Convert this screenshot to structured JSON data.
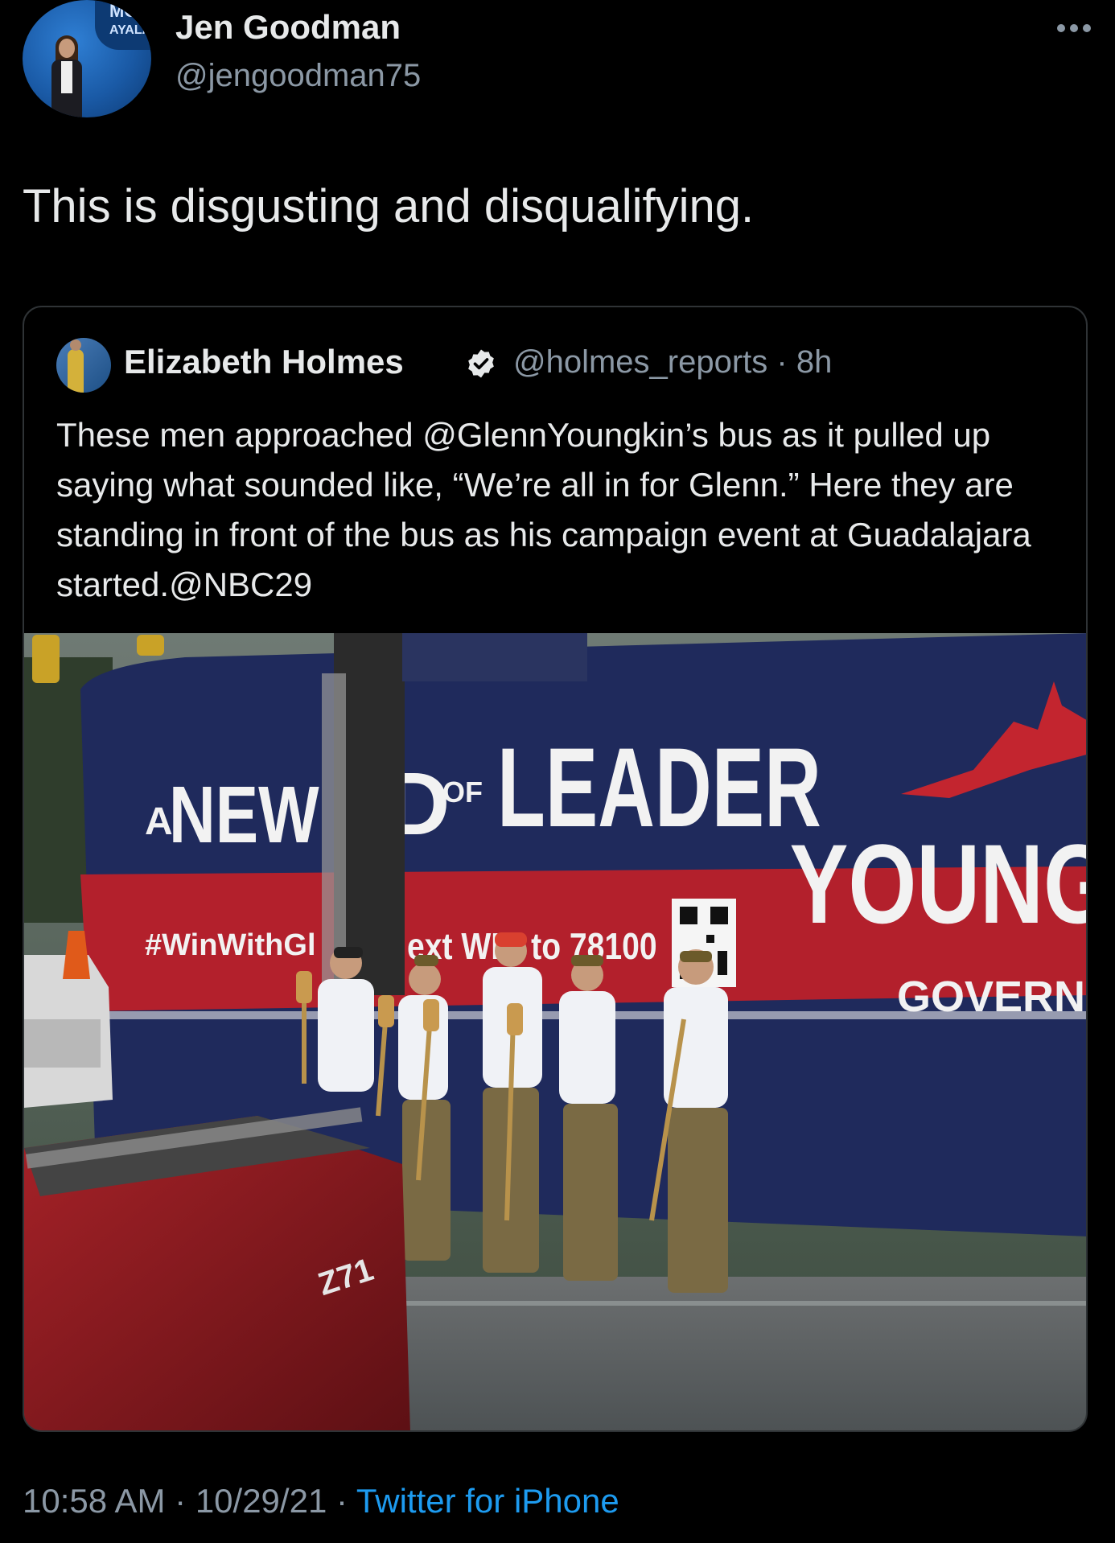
{
  "tweet": {
    "author_name": "Jen Goodman",
    "author_handle": "@jengoodman75",
    "text": "This is disgusting and disqualifying.",
    "time": "10:58 AM",
    "date": "10/29/21",
    "separator": "·",
    "source": "Twitter for iPhone"
  },
  "quoted_tweet": {
    "author_name": "Elizabeth Holmes",
    "author_handle": "@holmes_reports",
    "age": "8h",
    "text": "These men approached @GlennYoungkin’s bus as it pulled up saying what sounded like, “We’re all in for Glenn.” Here they are standing in front of the bus as his campaign event at Guadalajara started.@NBC29"
  },
  "photo_text": {
    "avatar_sign_1": "MCA",
    "avatar_sign_2": "AYALA",
    "bus_a": "A",
    "bus_new": "NEW",
    "bus_d": "D",
    "bus_of": "OF",
    "bus_leader": "LEADER",
    "bus_hashtag": "#WinWithGl",
    "bus_text_win": "ext WIN to 78100",
    "bus_youngkin": "YOUNGI",
    "bus_governor": "GOVERNO",
    "truck_badge": "Z71"
  },
  "colors": {
    "background": "#000000",
    "text": "#e7e9ea",
    "secondary": "#8b98a5",
    "link": "#1d9bf0",
    "border": "#2f3336",
    "bus_blue": "#1f2a5c",
    "bus_red": "#b3202c",
    "truck_red": "#8e1b1f"
  },
  "icons": {
    "more": "more-dots-icon",
    "verified": "verified-badge-icon"
  }
}
